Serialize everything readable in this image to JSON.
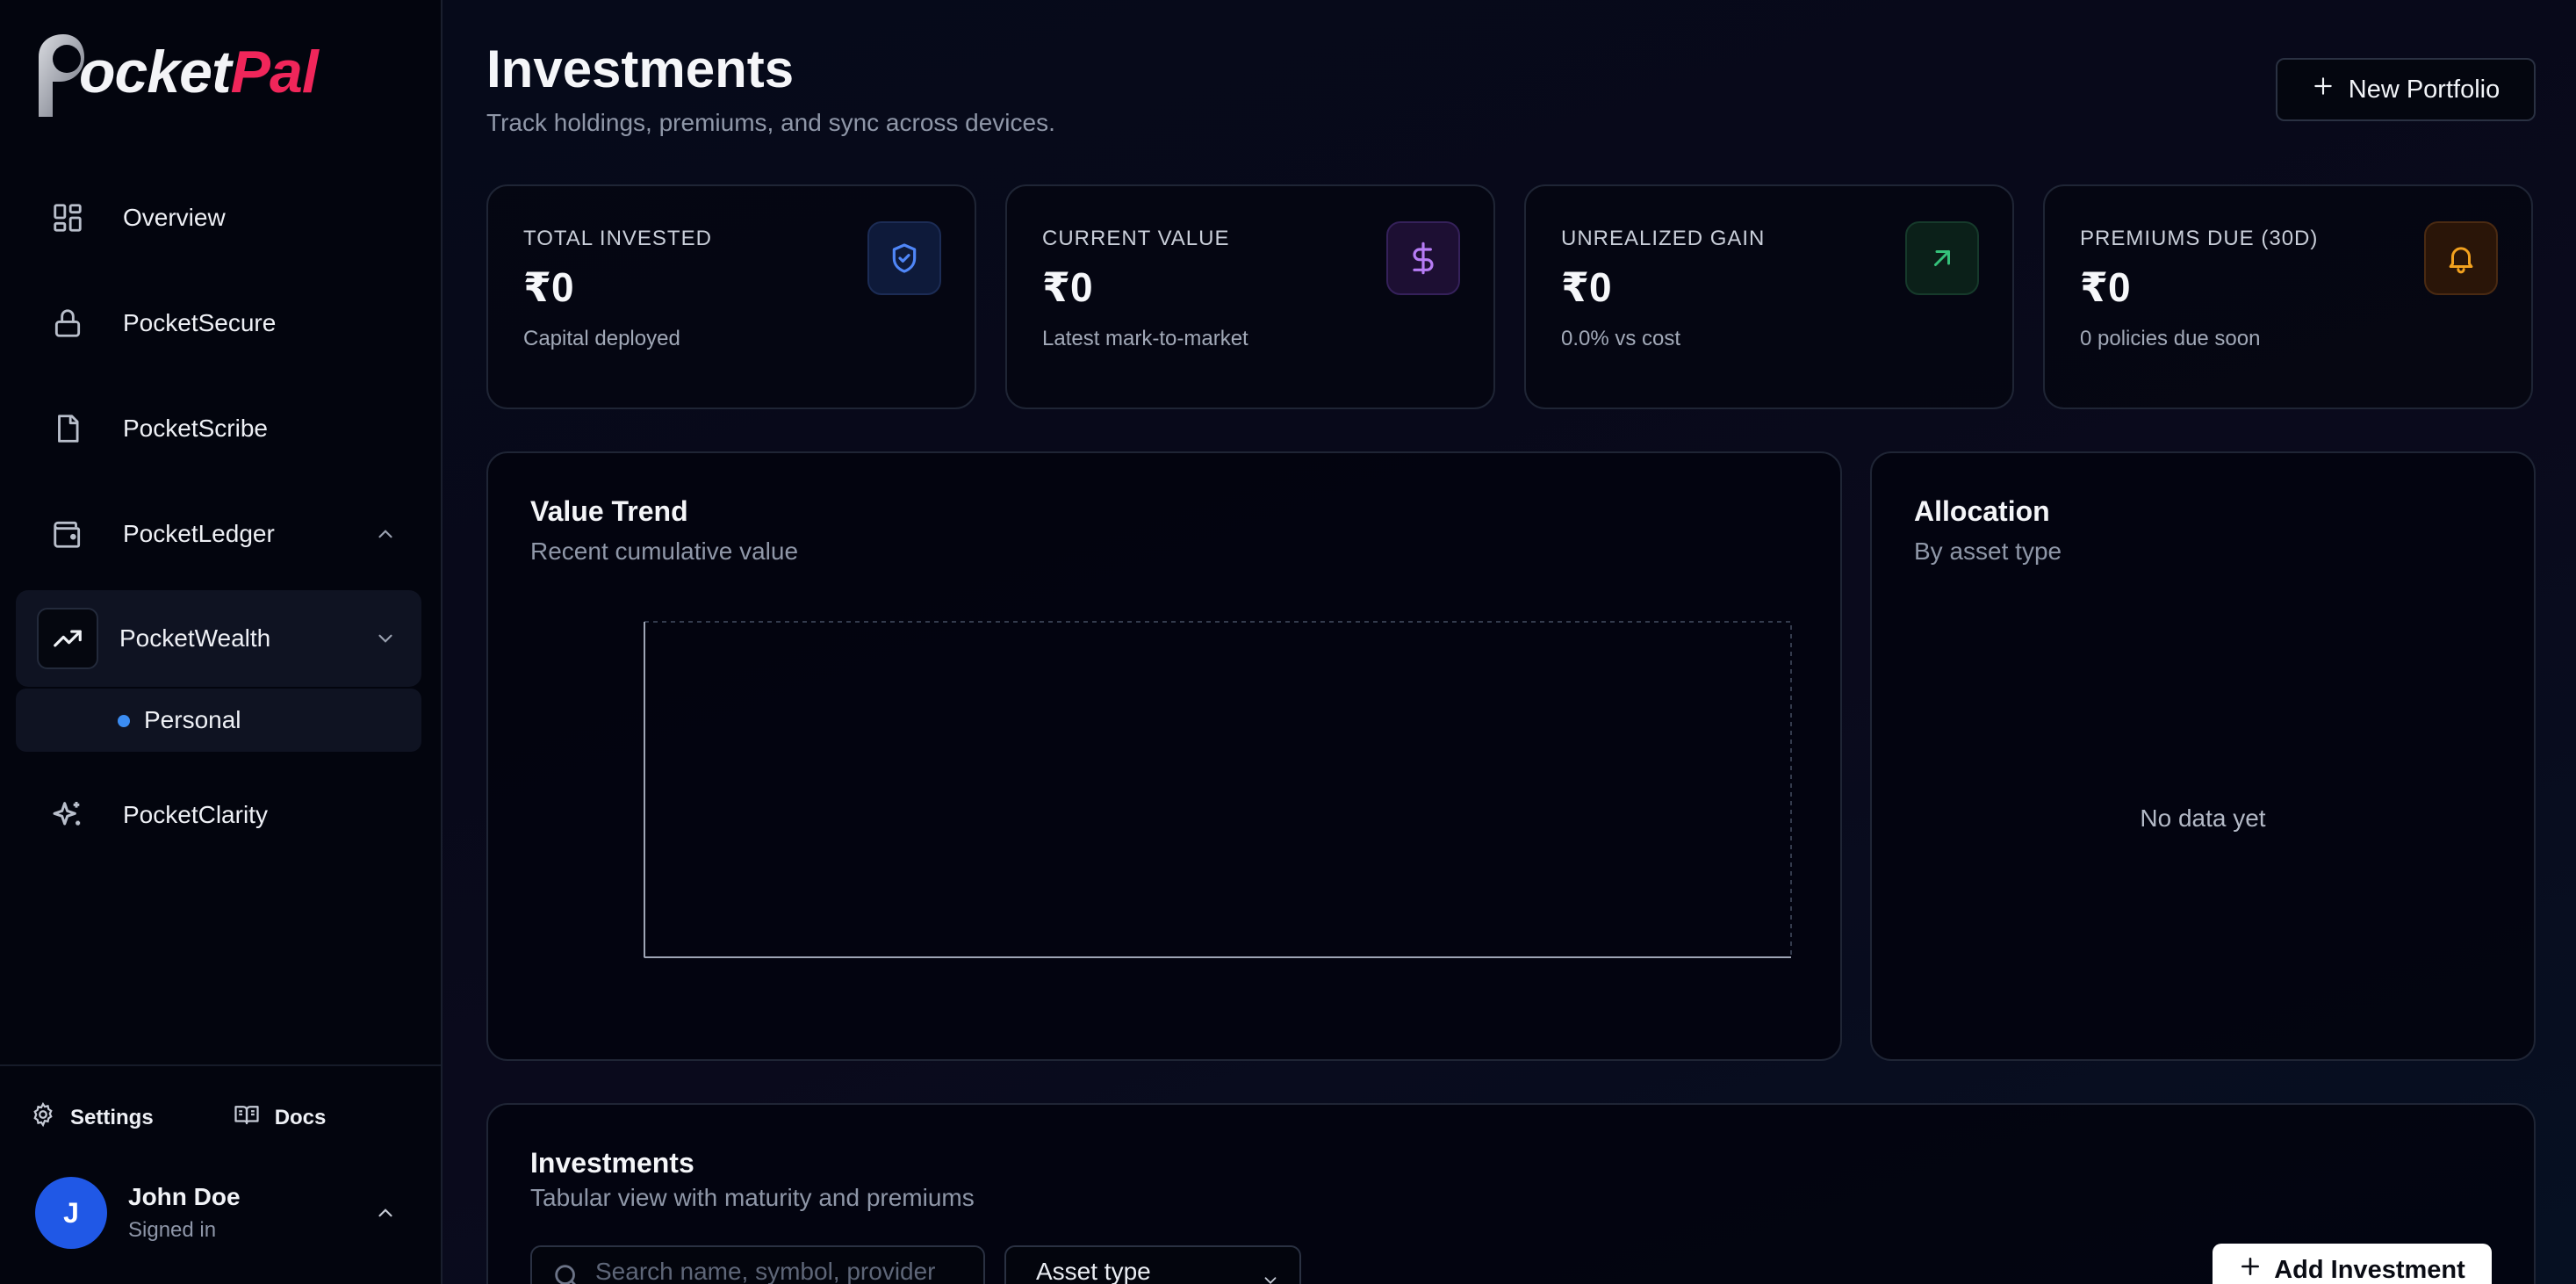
{
  "brand": {
    "logo_a": "ocket",
    "logo_b": "Pal"
  },
  "sidebar": {
    "items": [
      {
        "label": "Overview",
        "icon": "grid-icon"
      },
      {
        "label": "PocketSecure",
        "icon": "lock-icon"
      },
      {
        "label": "PocketScribe",
        "icon": "file-icon"
      },
      {
        "label": "PocketLedger",
        "icon": "wallet-icon",
        "chevron": "up"
      },
      {
        "label": "PocketWealth",
        "icon": "trending-up-icon",
        "chevron": "down",
        "active": true
      },
      {
        "label": "PocketClarity",
        "icon": "sparkles-icon"
      }
    ],
    "sub_items": [
      {
        "label": "Personal"
      }
    ],
    "footer": {
      "settings_label": "Settings",
      "docs_label": "Docs"
    },
    "user": {
      "initial": "J",
      "name": "John Doe",
      "status": "Signed in"
    }
  },
  "header": {
    "title": "Investments",
    "subtitle": "Track holdings, premiums, and sync across devices.",
    "new_portfolio_label": "New Portfolio"
  },
  "stats": [
    {
      "label": "TOTAL INVESTED",
      "value": "₹0",
      "detail": "Capital deployed",
      "icon": "shield-check-icon",
      "color": "#4f86f7",
      "bg": "#0e1a3a"
    },
    {
      "label": "CURRENT VALUE",
      "value": "₹0",
      "detail": "Latest mark-to-market",
      "icon": "dollar-icon",
      "color": "#b67cf5",
      "bg": "#1d0f33"
    },
    {
      "label": "UNREALIZED GAIN",
      "value": "₹0",
      "detail": "0.0% vs cost",
      "icon": "arrow-up-right-icon",
      "color": "#34c17a",
      "bg": "#0b2019"
    },
    {
      "label": "PREMIUMS DUE (30D)",
      "value": "₹0",
      "detail": "0 policies due soon",
      "icon": "bell-icon",
      "color": "#f2a11e",
      "bg": "#2a1508"
    }
  ],
  "value_trend": {
    "title": "Value Trend",
    "subtitle": "Recent cumulative value"
  },
  "allocation": {
    "title": "Allocation",
    "subtitle": "By asset type",
    "empty_text": "No data yet"
  },
  "investments": {
    "title": "Investments",
    "subtitle": "Tabular view with maturity and premiums",
    "search_placeholder": "Search name, symbol, provider",
    "asset_type_label": "Asset type",
    "add_label": "Add Investment"
  },
  "chart_data": {
    "type": "line",
    "title": "Value Trend",
    "subtitle": "Recent cumulative value",
    "series": [],
    "grid": false
  }
}
